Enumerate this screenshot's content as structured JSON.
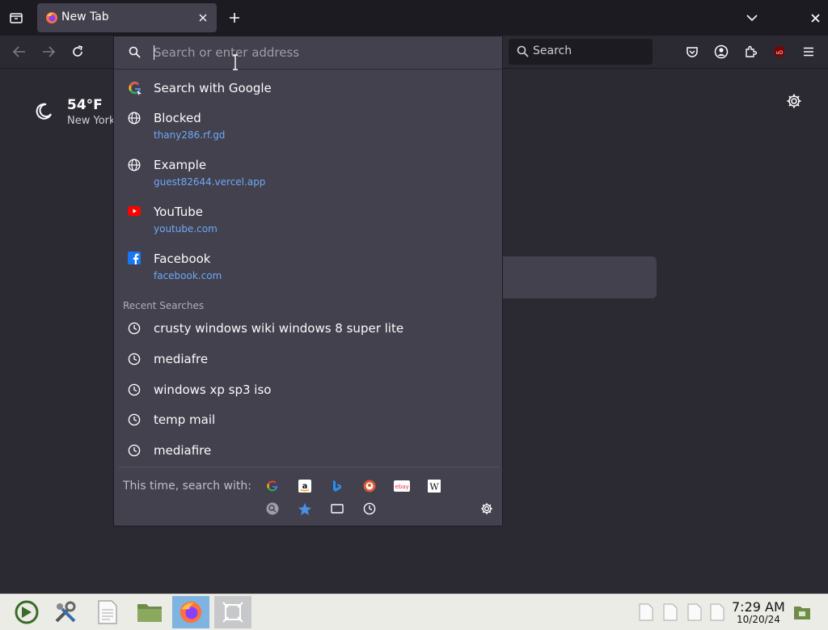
{
  "tab": {
    "title": "New Tab"
  },
  "toolbar": {
    "search_placeholder": "Search"
  },
  "weather": {
    "temp": "54°F",
    "city": "New York"
  },
  "urlbar": {
    "placeholder": "Search or enter address",
    "results": [
      {
        "title": "Search with Google",
        "icon": "google-icon"
      },
      {
        "title": "Blocked",
        "url": "thany286.rf.gd",
        "icon": "globe-icon"
      },
      {
        "title": "Example",
        "url": "guest82644.vercel.app",
        "icon": "globe-icon"
      },
      {
        "title": "YouTube",
        "url": "youtube.com",
        "icon": "youtube-icon"
      },
      {
        "title": "Facebook",
        "url": "facebook.com",
        "icon": "facebook-icon"
      }
    ],
    "recent_header": "Recent Searches",
    "recent_searches": [
      "crusty windows wiki windows 8 super lite",
      "mediafre",
      "windows xp sp3 iso",
      "temp mail",
      "mediafire"
    ],
    "oneoff_label": "This time, search with:",
    "engines": [
      "google",
      "amazon",
      "bing",
      "duckduckgo",
      "ebay",
      "wikipedia"
    ],
    "modes": [
      "search-mode",
      "bookmarks",
      "tabs",
      "history"
    ]
  },
  "clock": {
    "time": "7:29 AM",
    "date": "10/20/24"
  },
  "colors": {
    "accent": "#6fa8f5",
    "popup": "#42414d",
    "background": "#2b2a33"
  }
}
